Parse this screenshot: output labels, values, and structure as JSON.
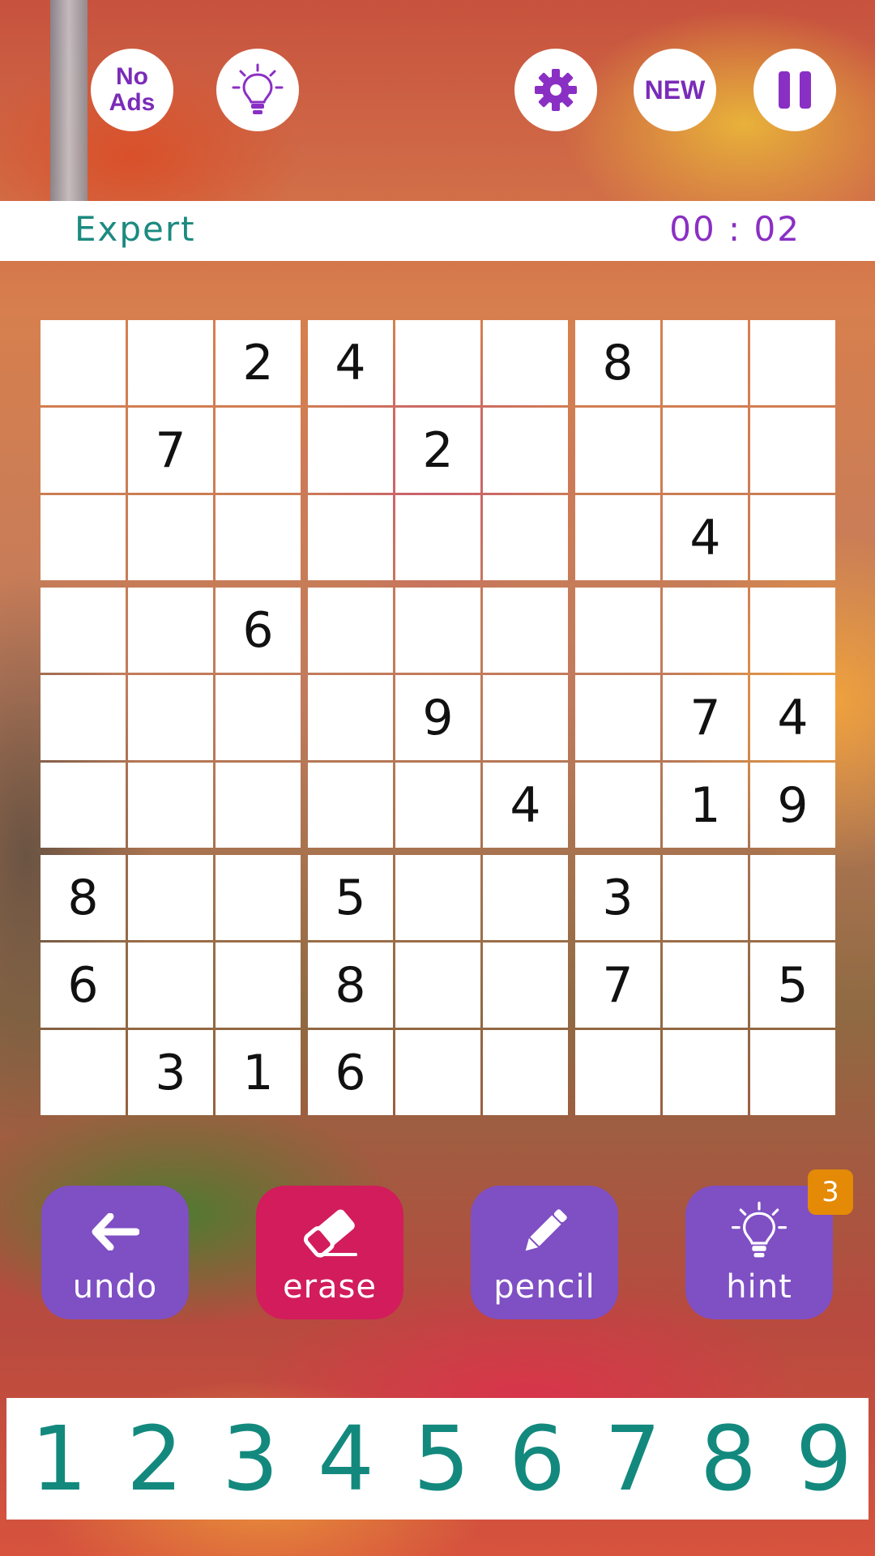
{
  "toolbar": {
    "no_ads_line1": "No",
    "no_ads_line2": "Ads",
    "new_label": "NEW",
    "icons": [
      "lightbulb-icon",
      "gear-icon",
      "pause-icon"
    ]
  },
  "status": {
    "difficulty": "Expert",
    "timer": "00 : 02"
  },
  "board": {
    "rows": [
      [
        "",
        "",
        "2",
        "4",
        "",
        "",
        "8",
        "",
        ""
      ],
      [
        "",
        "7",
        "",
        "",
        "2",
        "",
        "",
        "",
        ""
      ],
      [
        "",
        "",
        "",
        "",
        "",
        "",
        "",
        "4",
        ""
      ],
      [
        "",
        "",
        "6",
        "",
        "",
        "",
        "",
        "",
        ""
      ],
      [
        "",
        "",
        "",
        "",
        "9",
        "",
        "",
        "7",
        "4"
      ],
      [
        "",
        "",
        "",
        "",
        "",
        "4",
        "",
        "1",
        "9"
      ],
      [
        "8",
        "",
        "",
        "5",
        "",
        "",
        "3",
        "",
        ""
      ],
      [
        "6",
        "",
        "",
        "8",
        "",
        "",
        "7",
        "",
        "5"
      ],
      [
        "",
        "3",
        "1",
        "6",
        "",
        "",
        "",
        "",
        ""
      ]
    ]
  },
  "actions": {
    "undo": "undo",
    "erase": "erase",
    "pencil": "pencil",
    "hint": "hint",
    "hint_count": "3"
  },
  "numpad": [
    "1",
    "2",
    "3",
    "4",
    "5",
    "6",
    "7",
    "8",
    "9"
  ],
  "colors": {
    "accent_purple": "#7f4fc4",
    "erase_pink": "#d21c5b",
    "digit_teal": "#13897e",
    "badge_orange": "#e48a06"
  }
}
